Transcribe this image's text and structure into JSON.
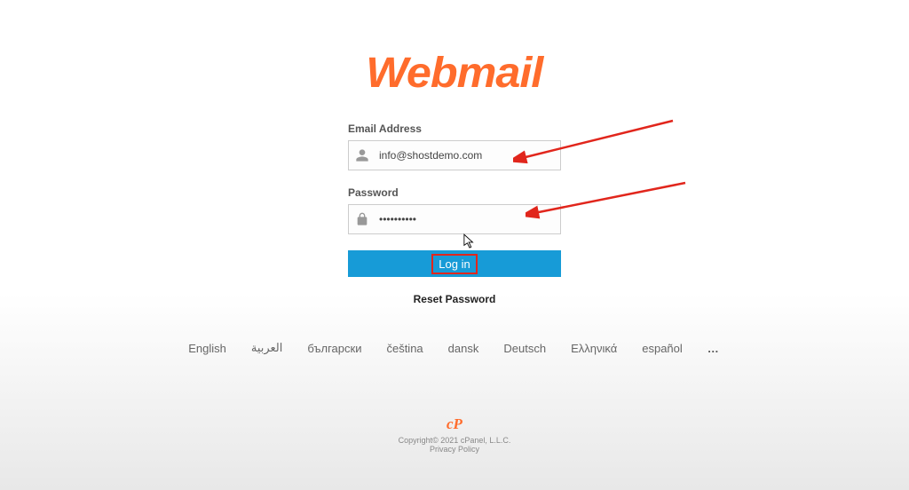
{
  "logo_text": "Webmail",
  "form": {
    "email_label": "Email Address",
    "email_value": "info@shostdemo.com",
    "password_label": "Password",
    "password_value": "••••••••••",
    "login_button": "Log in",
    "reset_link": "Reset Password"
  },
  "languages": {
    "items": [
      "English",
      "العربية",
      "български",
      "čeština",
      "dansk",
      "Deutsch",
      "Ελληνικά",
      "español"
    ],
    "more": "…"
  },
  "footer": {
    "cp_logo": "cP",
    "copyright": "Copyright© 2021 cPanel, L.L.C.",
    "privacy": "Privacy Policy"
  },
  "colors": {
    "brand_orange": "#ff6c2c",
    "button_blue": "#179bd7",
    "annotation_red": "#e1261c"
  }
}
